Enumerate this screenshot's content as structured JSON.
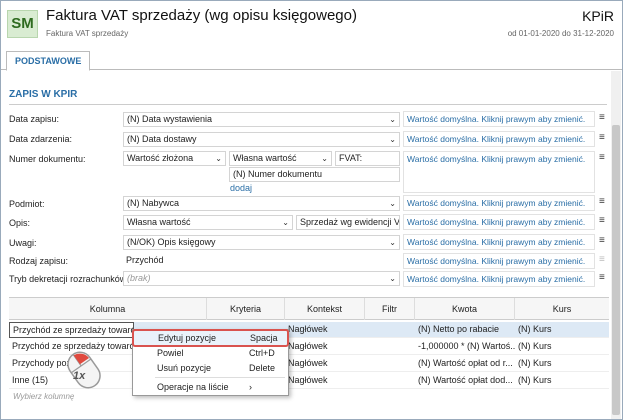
{
  "header": {
    "badge": "SM",
    "title": "Faktura VAT sprzedaży (wg opisu księgowego)",
    "subtitle": "Faktura VAT sprzedaży",
    "register": "KPiR",
    "period": "od 01-01-2020 do 31-12-2020"
  },
  "tabs": [
    {
      "label": "PODSTAWOWE"
    }
  ],
  "section": {
    "title": "ZAPIS W KPIR"
  },
  "default_hint": "Wartość domyślna. Kliknij prawym aby zmienić.",
  "fields": {
    "data_zapisu": {
      "label": "Data zapisu:",
      "value": "(N) Data wystawienia"
    },
    "data_zdarzenia": {
      "label": "Data zdarzenia:",
      "value": "(N) Data dostawy"
    },
    "numer_dokumentu": {
      "label": "Numer dokumentu:",
      "part1": "Wartość złożona",
      "part2": "Własna wartość",
      "part3": "FVAT:",
      "part4": "(N) Numer dokumentu",
      "add_link": "dodaj"
    },
    "podmiot": {
      "label": "Podmiot:",
      "value": "(N) Nabywca"
    },
    "opis": {
      "label": "Opis:",
      "value": "Własna wartość",
      "text": "Sprzedaż wg ewidencji VAT"
    },
    "uwagi": {
      "label": "Uwagi:",
      "value": "(N/OK) Opis księgowy"
    },
    "rodzaj_zapisu": {
      "label": "Rodzaj zapisu:",
      "value": "Przychód"
    },
    "tryb": {
      "label": "Tryb dekretacji rozrachunków:",
      "placeholder": "(brak)"
    }
  },
  "grid": {
    "headers": [
      "Kolumna",
      "Kryteria",
      "Kontekst",
      "Filtr",
      "Kwota",
      "Kurs"
    ],
    "rows": [
      {
        "kolumna": "Przychód ze sprzedaży towarów",
        "kryteria": "",
        "kontekst": "Nagłówek",
        "filtr": "",
        "kwota": "(N) Netto po rabacie",
        "kurs": "(N) Kurs"
      },
      {
        "kolumna": "Przychód ze sprzedaży towarów",
        "kryteria": "",
        "kontekst": "Nagłówek",
        "filtr": "",
        "kwota": "-1,000000 * (N) Wartoś...",
        "kurs": "(N) Kurs"
      },
      {
        "kolumna": "Przychody pozo...",
        "kryteria": "",
        "kontekst": "Nagłówek",
        "filtr": "",
        "kwota": "(N) Wartość opłat od r...",
        "kurs": "(N) Kurs"
      },
      {
        "kolumna": "Inne (15)",
        "kryteria": "",
        "kontekst": "Nagłówek",
        "filtr": "",
        "kwota": "(N) Wartość opłat dod...",
        "kurs": "(N) Kurs"
      }
    ],
    "add_placeholder": "Wybierz kolumnę"
  },
  "context_menu": {
    "items": [
      {
        "label": "Edytuj pozycje",
        "shortcut": "Spacja"
      },
      {
        "label": "Powiel",
        "shortcut": "Ctrl+D"
      },
      {
        "label": "Usuń pozycje",
        "shortcut": "Delete"
      },
      {
        "label": "Operacje na liście",
        "shortcut": "›"
      }
    ]
  },
  "mouse_hint": "1x",
  "colors": {
    "accent": "#2a6ea6",
    "badge_bg": "#d9ecd2",
    "highlight": "#d9534f"
  }
}
